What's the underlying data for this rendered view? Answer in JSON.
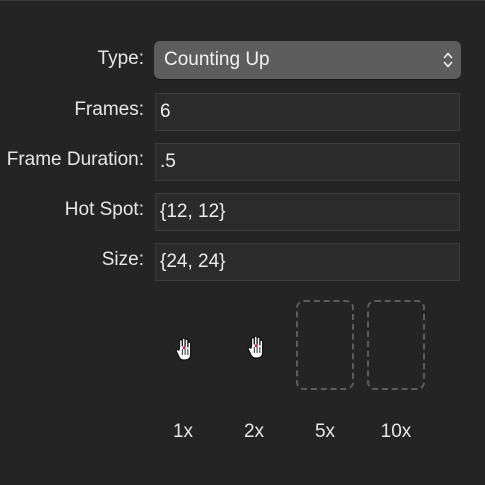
{
  "form": {
    "type_label": "Type:",
    "type_value": "Counting Up",
    "frames_label": "Frames:",
    "frames_value": "6",
    "frame_duration_label": "Frame Duration:",
    "frame_duration_value": ".5",
    "hot_spot_label": "Hot Spot:",
    "hot_spot_value": "{12, 12}",
    "size_label": "Size:",
    "size_value": "{24, 24}"
  },
  "previews": {
    "scales": [
      {
        "label": "1x",
        "icon": "hand-cursor-icon",
        "has_image": true
      },
      {
        "label": "2x",
        "icon": "hand-cursor-icon",
        "has_image": true
      },
      {
        "label": "5x",
        "icon": "empty-image-well",
        "has_image": false
      },
      {
        "label": "10x",
        "icon": "empty-image-well",
        "has_image": false
      }
    ]
  },
  "colors": {
    "background": "#242424",
    "popup_background": "#5d5d5d",
    "field_background": "#2b2b2b",
    "hotspot_marker": "#d0103a"
  }
}
